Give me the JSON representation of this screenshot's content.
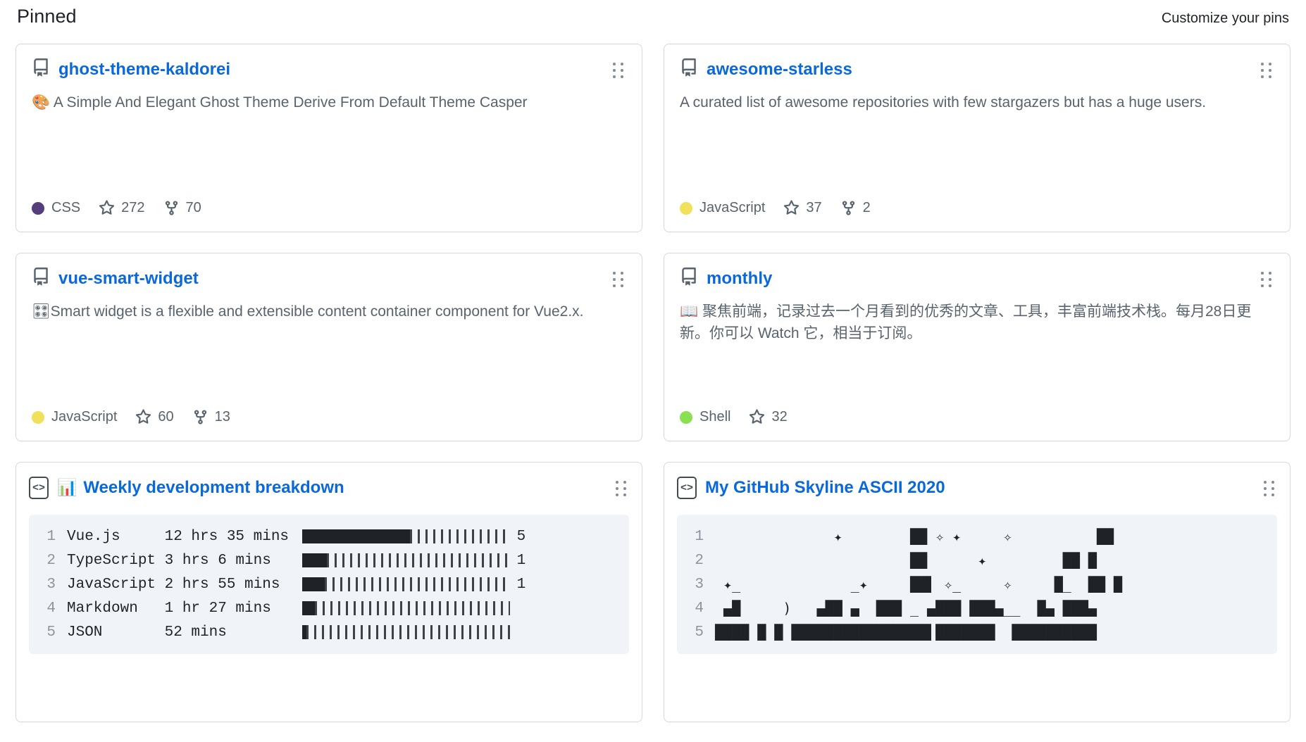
{
  "header": {
    "title": "Pinned",
    "customize_label": "Customize your pins"
  },
  "colors": {
    "link": "#0969da",
    "css": "#563d7c",
    "javascript": "#f1e05a",
    "shell": "#89e051",
    "border": "#d1d9e0",
    "muted": "#59636e",
    "code_bg": "#f0f4f8"
  },
  "pins": [
    {
      "kind": "repo",
      "icon": "repo-icon",
      "name": "ghost-theme-kaldorei",
      "description_emoji": "🎨",
      "description": " A Simple And Elegant Ghost Theme Derive From Default Theme Casper",
      "language": "CSS",
      "language_color": "#563d7c",
      "stars": "272",
      "forks": "70"
    },
    {
      "kind": "repo",
      "icon": "repo-icon",
      "name": "awesome-starless",
      "description_emoji": "",
      "description": "A curated list of awesome repositories with few stargazers but has a huge users.",
      "language": "JavaScript",
      "language_color": "#f1e05a",
      "stars": "37",
      "forks": "2"
    },
    {
      "kind": "repo",
      "icon": "repo-icon",
      "name": "vue-smart-widget",
      "description_emoji": "🎛",
      "description": "Smart widget is a flexible and extensible content container component for Vue2.x.",
      "language": "JavaScript",
      "language_color": "#f1e05a",
      "stars": "60",
      "forks": "13"
    },
    {
      "kind": "repo",
      "icon": "repo-icon",
      "name": "monthly",
      "description_emoji": "📖",
      "description": " 聚焦前端，记录过去一个月看到的优秀的文章、工具，丰富前端技术栈。每月28日更新。你可以 Watch 它，相当于订阅。",
      "language": "Shell",
      "language_color": "#89e051",
      "stars": "32",
      "forks": ""
    }
  ],
  "gists": [
    {
      "kind": "gist",
      "icon": "code-icon",
      "title_emoji": "📊",
      "name": "Weekly development breakdown",
      "lines": [
        {
          "n": "1",
          "lang": "Vue.js",
          "time": "12 hrs 35 mins",
          "fill_pct": 52,
          "pct": "5"
        },
        {
          "n": "2",
          "lang": "TypeScript",
          "time": "3 hrs 6 mins",
          "fill_pct": 12,
          "pct": "1"
        },
        {
          "n": "3",
          "lang": "JavaScript",
          "time": "2 hrs 55 mins",
          "fill_pct": 11,
          "pct": "1"
        },
        {
          "n": "4",
          "lang": "Markdown",
          "time": "1 hr 27 mins",
          "fill_pct": 6,
          "pct": ""
        },
        {
          "n": "5",
          "lang": "JSON",
          "time": "52 mins",
          "fill_pct": 2,
          "pct": ""
        }
      ]
    },
    {
      "kind": "gist",
      "icon": "code-icon",
      "title_emoji": "",
      "name": "My GitHub Skyline ASCII 2020",
      "lines": [
        {
          "n": "1",
          "art": "              ✦        ██ ✧ ✦     ✧          ██"
        },
        {
          "n": "2",
          "art": "                       ██      ✦         ██ █"
        },
        {
          "n": "3",
          "art": " ✦_             _✦     ██▌ ✧_     ✧     █_  ██ █"
        },
        {
          "n": "4",
          "art": " ▄█     )   ▄██ ▄  ███ _ ▄███ ███▄__  █▄ ███▄"
        },
        {
          "n": "5",
          "art": "████ █ █ ████████████████▌███████  ██████████"
        }
      ]
    }
  ]
}
